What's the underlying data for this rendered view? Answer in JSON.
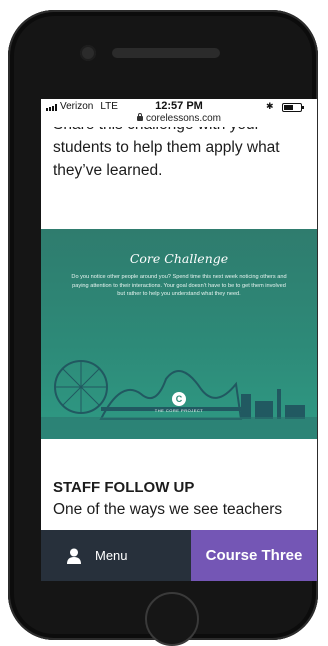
{
  "status_bar": {
    "carrier": "Verizon",
    "network": "LTE",
    "time": "12:57 PM",
    "url": "corelessons.com",
    "bluetooth_icon": "bluetooth-icon",
    "battery_level": 0.55
  },
  "content": {
    "intro_text": "Share this challenge with your students to help them apply what they’ve learned.",
    "challenge": {
      "title": "Core Challenge",
      "body": "Do you notice other people around you? Spend time this next week noticing others and paying attention to their interactions. Your goal doesn’t have to be to get them involved but rather to help you understand what they need.",
      "logo_letter": "C",
      "brand": "THE CORE PROJECT"
    },
    "section_heading": "STAFF FOLLOW UP",
    "section_text": "One of the ways we see teachers"
  },
  "bottom_bar": {
    "menu_label": "Menu",
    "course_label": "Course Three"
  },
  "colors": {
    "challenge_bg": "#2d8a78",
    "menu_bg": "#27303b",
    "course_bg": "#7456b5"
  }
}
